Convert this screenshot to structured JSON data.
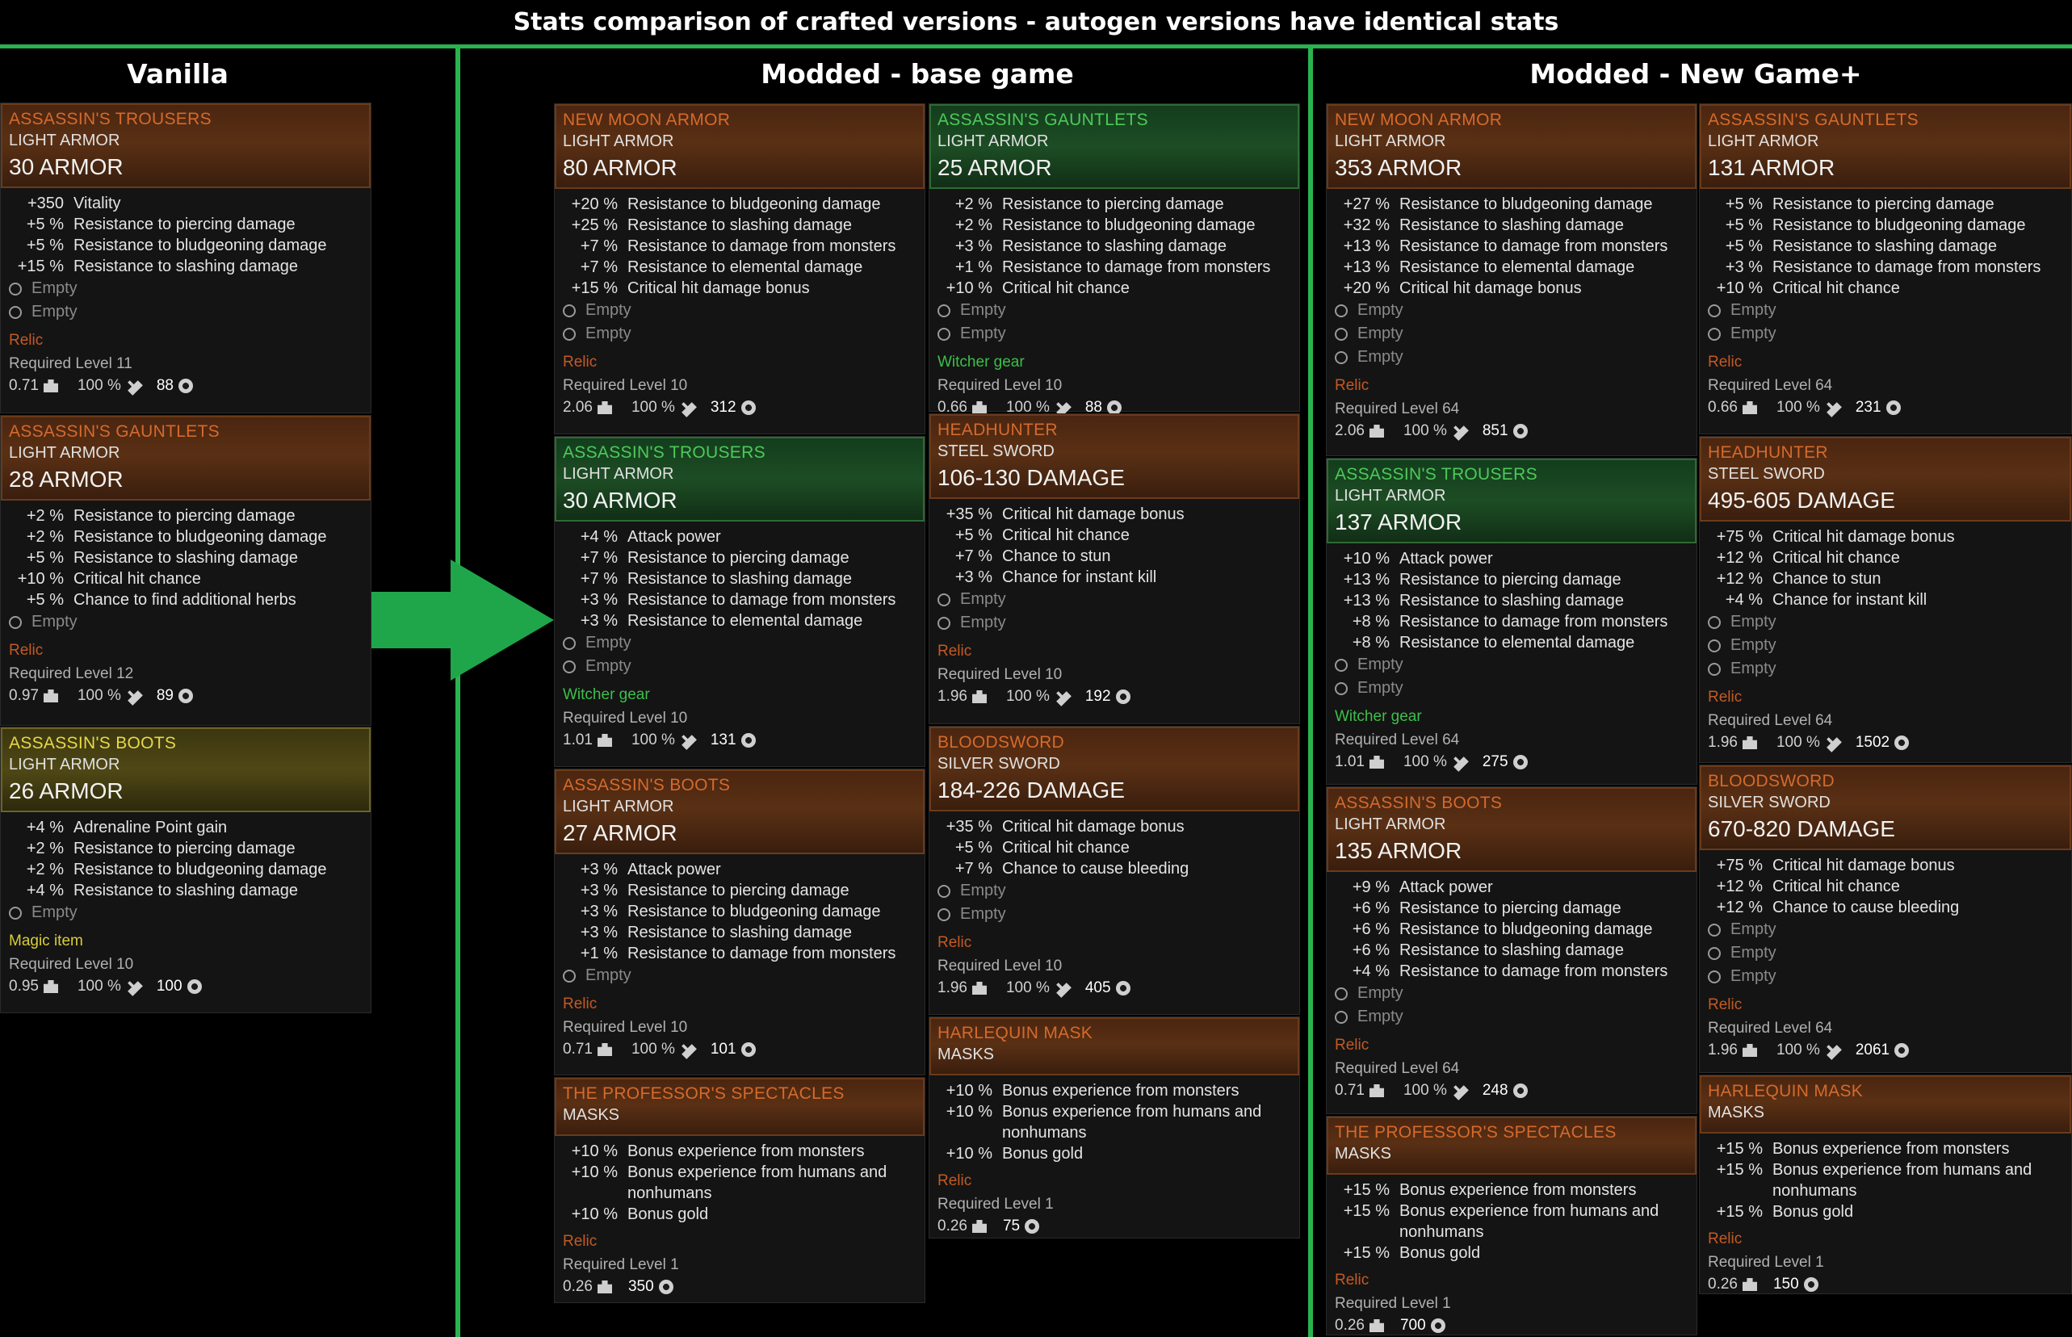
{
  "page_title": "Stats comparison of crafted versions - autogen versions have identical stats",
  "columns": {
    "vanilla": "Vanilla",
    "modded_base": "Modded - base game",
    "modded_ngp": "Modded  - New Game+"
  },
  "colors": {
    "divider": "#29b34f",
    "relic": "#c35a24",
    "witcher_gear": "#3cbf4a",
    "magic_item": "#d8cd3a"
  },
  "empty_label": "Empty",
  "cards": {
    "v_trousers": {
      "name": "ASSASSIN'S TROUSERS",
      "type": "LIGHT ARMOR",
      "value": "30 ARMOR",
      "stats": [
        [
          "+350",
          "Vitality"
        ],
        [
          "+5 %",
          "Resistance to piercing damage"
        ],
        [
          "+5 %",
          "Resistance to bludgeoning damage"
        ],
        [
          "+15 %",
          "Resistance to slashing damage"
        ]
      ],
      "rarity": "Relic",
      "level": "Required Level 11",
      "weight": "0.71",
      "durability": "100 %",
      "price": "88"
    },
    "v_gauntlets": {
      "name": "ASSASSIN'S GAUNTLETS",
      "type": "LIGHT ARMOR",
      "value": "28 ARMOR",
      "stats": [
        [
          "+2 %",
          "Resistance to piercing damage"
        ],
        [
          "+2 %",
          "Resistance to bludgeoning damage"
        ],
        [
          "+5 %",
          "Resistance to slashing damage"
        ],
        [
          "+10 %",
          "Critical hit chance"
        ],
        [
          "+5 %",
          "Chance to find additional herbs"
        ]
      ],
      "rarity": "Relic",
      "level": "Required Level 12",
      "weight": "0.97",
      "durability": "100 %",
      "price": "89"
    },
    "v_boots": {
      "name": "ASSASSIN'S BOOTS",
      "type": "LIGHT ARMOR",
      "value": "26 ARMOR",
      "stats": [
        [
          "+4 %",
          "Adrenaline Point gain"
        ],
        [
          "+2 %",
          "Resistance to piercing damage"
        ],
        [
          "+2 %",
          "Resistance to bludgeoning damage"
        ],
        [
          "+4 %",
          "Resistance to slashing damage"
        ]
      ],
      "rarity": "Magic item",
      "level": "Required Level 10",
      "weight": "0.95",
      "durability": "100 %",
      "price": "100"
    },
    "b_newmoon": {
      "name": "NEW MOON ARMOR",
      "type": "LIGHT ARMOR",
      "value": "80 ARMOR",
      "stats": [
        [
          "+20 %",
          "Resistance to bludgeoning damage"
        ],
        [
          "+25 %",
          "Resistance to slashing damage"
        ],
        [
          "+7 %",
          "Resistance to damage from monsters"
        ],
        [
          "+7 %",
          "Resistance to elemental damage"
        ],
        [
          "+15 %",
          "Critical hit damage bonus"
        ]
      ],
      "rarity": "Relic",
      "level": "Required Level 10",
      "weight": "2.06",
      "durability": "100 %",
      "price": "312"
    },
    "b_trousers": {
      "name": "ASSASSIN'S TROUSERS",
      "type": "LIGHT ARMOR",
      "value": "30 ARMOR",
      "stats": [
        [
          "+4 %",
          "Attack power"
        ],
        [
          "+7 %",
          "Resistance to piercing damage"
        ],
        [
          "+7 %",
          "Resistance to slashing damage"
        ],
        [
          "+3 %",
          "Resistance to damage from monsters"
        ],
        [
          "+3 %",
          "Resistance to elemental damage"
        ]
      ],
      "rarity": "Witcher gear",
      "level": "Required Level 10",
      "weight": "1.01",
      "durability": "100 %",
      "price": "131"
    },
    "b_boots": {
      "name": "ASSASSIN'S BOOTS",
      "type": "LIGHT ARMOR",
      "value": "27 ARMOR",
      "stats": [
        [
          "+3 %",
          "Attack power"
        ],
        [
          "+3 %",
          "Resistance to piercing damage"
        ],
        [
          "+3 %",
          "Resistance to bludgeoning damage"
        ],
        [
          "+3 %",
          "Resistance to slashing damage"
        ],
        [
          "+1 %",
          "Resistance to damage from monsters"
        ]
      ],
      "rarity": "Relic",
      "level": "Required Level 10",
      "weight": "0.71",
      "durability": "100 %",
      "price": "101"
    },
    "b_spectacles": {
      "name": "THE PROFESSOR'S SPECTACLES",
      "type": "MASKS",
      "stats": [
        [
          "+10 %",
          "Bonus experience from monsters"
        ],
        [
          "+10 %",
          "Bonus experience from humans and nonhumans"
        ],
        [
          "+10 %",
          "Bonus gold"
        ]
      ],
      "rarity": "Relic",
      "level": "Required Level 1",
      "weight": "0.26",
      "price": "350"
    },
    "b_gauntlets": {
      "name": "ASSASSIN'S GAUNTLETS",
      "type": "LIGHT ARMOR",
      "value": "25 ARMOR",
      "stats": [
        [
          "+2 %",
          "Resistance to piercing damage"
        ],
        [
          "+2 %",
          "Resistance to bludgeoning damage"
        ],
        [
          "+3 %",
          "Resistance to slashing damage"
        ],
        [
          "+1 %",
          "Resistance to damage from monsters"
        ],
        [
          "+10 %",
          "Critical hit chance"
        ]
      ],
      "rarity": "Witcher gear",
      "level": "Required Level 10",
      "weight": "0.66",
      "durability": "100 %",
      "price": "88"
    },
    "b_headhunter": {
      "name": "HEADHUNTER",
      "type": "STEEL SWORD",
      "value": "106-130 DAMAGE",
      "stats": [
        [
          "+35 %",
          "Critical hit damage bonus"
        ],
        [
          "+5 %",
          "Critical hit chance"
        ],
        [
          "+7 %",
          "Chance to stun"
        ],
        [
          "+3 %",
          "Chance for instant kill"
        ]
      ],
      "rarity": "Relic",
      "level": "Required Level 10",
      "weight": "1.96",
      "durability": "100 %",
      "price": "192"
    },
    "b_bloodsword": {
      "name": "BLOODSWORD",
      "type": "SILVER SWORD",
      "value": "184-226 DAMAGE",
      "stats": [
        [
          "+35 %",
          "Critical hit damage bonus"
        ],
        [
          "+5 %",
          "Critical hit chance"
        ],
        [
          "+7 %",
          "Chance to cause bleeding"
        ]
      ],
      "rarity": "Relic",
      "level": "Required Level 10",
      "weight": "1.96",
      "durability": "100 %",
      "price": "405"
    },
    "b_harlequin": {
      "name": "HARLEQUIN MASK",
      "type": "MASKS",
      "stats": [
        [
          "+10 %",
          "Bonus experience from monsters"
        ],
        [
          "+10 %",
          "Bonus experience from humans and nonhumans"
        ],
        [
          "+10 %",
          "Bonus gold"
        ]
      ],
      "rarity": "Relic",
      "level": "Required Level 1",
      "weight": "0.26",
      "price": "75"
    },
    "n_newmoon": {
      "name": "NEW MOON ARMOR",
      "type": "LIGHT ARMOR",
      "value": "353 ARMOR",
      "stats": [
        [
          "+27 %",
          "Resistance to bludgeoning damage"
        ],
        [
          "+32 %",
          "Resistance to slashing damage"
        ],
        [
          "+13 %",
          "Resistance to damage from monsters"
        ],
        [
          "+13 %",
          "Resistance to elemental damage"
        ],
        [
          "+20 %",
          "Critical hit damage bonus"
        ]
      ],
      "rarity": "Relic",
      "level": "Required Level 64",
      "weight": "2.06",
      "durability": "100 %",
      "price": "851"
    },
    "n_trousers": {
      "name": "ASSASSIN'S TROUSERS",
      "type": "LIGHT ARMOR",
      "value": "137 ARMOR",
      "stats": [
        [
          "+10 %",
          "Attack power"
        ],
        [
          "+13 %",
          "Resistance to piercing damage"
        ],
        [
          "+13 %",
          "Resistance to slashing damage"
        ],
        [
          "+8 %",
          "Resistance to damage from monsters"
        ],
        [
          "+8 %",
          "Resistance to elemental damage"
        ]
      ],
      "rarity": "Witcher gear",
      "level": "Required Level 64",
      "weight": "1.01",
      "durability": "100 %",
      "price": "275"
    },
    "n_boots": {
      "name": "ASSASSIN'S BOOTS",
      "type": "LIGHT ARMOR",
      "value": "135 ARMOR",
      "stats": [
        [
          "+9 %",
          "Attack power"
        ],
        [
          "+6 %",
          "Resistance to piercing damage"
        ],
        [
          "+6 %",
          "Resistance to bludgeoning damage"
        ],
        [
          "+6 %",
          "Resistance to slashing damage"
        ],
        [
          "+4 %",
          "Resistance to damage from monsters"
        ]
      ],
      "rarity": "Relic",
      "level": "Required Level 64",
      "weight": "0.71",
      "durability": "100 %",
      "price": "248"
    },
    "n_spectacles": {
      "name": "THE PROFESSOR'S SPECTACLES",
      "type": "MASKS",
      "stats": [
        [
          "+15 %",
          "Bonus experience from monsters"
        ],
        [
          "+15 %",
          "Bonus experience from humans and nonhumans"
        ],
        [
          "+15 %",
          "Bonus gold"
        ]
      ],
      "rarity": "Relic",
      "level": "Required Level 1",
      "weight": "0.26",
      "price": "700"
    },
    "n_gauntlets": {
      "name": "ASSASSIN'S GAUNTLETS",
      "type": "LIGHT ARMOR",
      "value": "131 ARMOR",
      "stats": [
        [
          "+5 %",
          "Resistance to piercing damage"
        ],
        [
          "+5 %",
          "Resistance to bludgeoning damage"
        ],
        [
          "+5 %",
          "Resistance to slashing damage"
        ],
        [
          "+3 %",
          "Resistance to damage from monsters"
        ],
        [
          "+10 %",
          "Critical hit chance"
        ]
      ],
      "rarity": "Relic",
      "level": "Required Level 64",
      "weight": "0.66",
      "durability": "100 %",
      "price": "231"
    },
    "n_headhunter": {
      "name": "HEADHUNTER",
      "type": "STEEL SWORD",
      "value": "495-605 DAMAGE",
      "stats": [
        [
          "+75 %",
          "Critical hit damage bonus"
        ],
        [
          "+12 %",
          "Critical hit chance"
        ],
        [
          "+12 %",
          "Chance to stun"
        ],
        [
          "+4 %",
          "Chance for instant kill"
        ]
      ],
      "rarity": "Relic",
      "level": "Required Level 64",
      "weight": "1.96",
      "durability": "100 %",
      "price": "1502"
    },
    "n_bloodsword": {
      "name": "BLOODSWORD",
      "type": "SILVER SWORD",
      "value": "670-820 DAMAGE",
      "stats": [
        [
          "+75 %",
          "Critical hit damage bonus"
        ],
        [
          "+12 %",
          "Critical hit chance"
        ],
        [
          "+12 %",
          "Chance to cause bleeding"
        ]
      ],
      "rarity": "Relic",
      "level": "Required Level 64",
      "weight": "1.96",
      "durability": "100 %",
      "price": "2061"
    },
    "n_harlequin": {
      "name": "HARLEQUIN MASK",
      "type": "MASKS",
      "stats": [
        [
          "+15 %",
          "Bonus experience from monsters"
        ],
        [
          "+15 %",
          "Bonus experience from humans and nonhumans"
        ],
        [
          "+15 %",
          "Bonus gold"
        ]
      ],
      "rarity": "Relic",
      "level": "Required Level 1",
      "weight": "0.26",
      "price": "150"
    }
  }
}
